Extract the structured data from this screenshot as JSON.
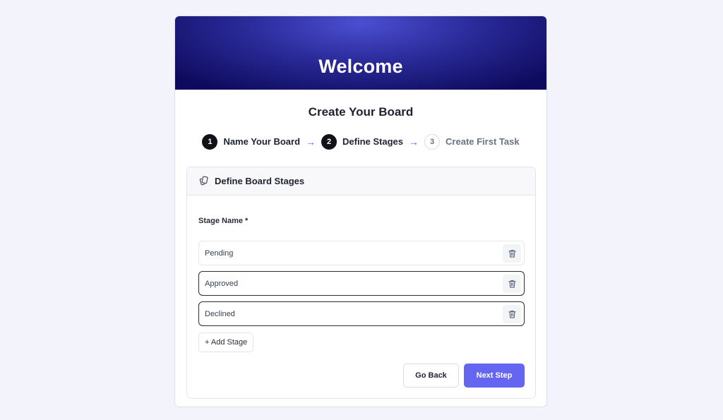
{
  "colors": {
    "accent": "#6466f1",
    "hero_dark": "#0e0b5e",
    "hero_light": "#4b4fd0",
    "page_bg": "#f3f4fb"
  },
  "hero": {
    "title": "Welcome"
  },
  "subtitle": "Create Your Board",
  "steps": [
    {
      "number": "1",
      "label": "Name Your Board",
      "state": "active"
    },
    {
      "number": "2",
      "label": "Define Stages",
      "state": "active"
    },
    {
      "number": "3",
      "label": "Create First Task",
      "state": "inactive"
    }
  ],
  "step_arrow_icon": "arrow-right-icon",
  "panel": {
    "header_icon": "cards-icon",
    "title": "Define Board Stages",
    "field_label": "Stage Name *",
    "stages": [
      {
        "value": "Pending",
        "delete_icon": "trash-icon"
      },
      {
        "value": "Approved",
        "delete_icon": "trash-icon"
      },
      {
        "value": "Declined",
        "delete_icon": "trash-icon"
      }
    ],
    "add_stage_label": "+ Add Stage"
  },
  "actions": {
    "back_label": "Go Back",
    "next_label": "Next Step"
  }
}
